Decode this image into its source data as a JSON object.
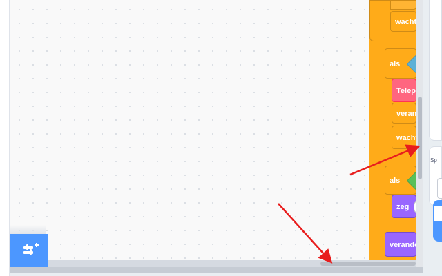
{
  "code_blocks": {
    "wacht_1": "wacht",
    "als_1": "als",
    "teleport": "Telepo",
    "verander_1": "verand",
    "wacht_2": "wacht",
    "als_2": "als",
    "zeg": "zeg",
    "verander_2": "verander"
  },
  "side_panel": {
    "label": "Sp"
  },
  "colors": {
    "control": "#ffab19",
    "looks": "#9966ff",
    "custom": "#ff6680",
    "operators_green": "#59c059",
    "sensing_blue": "#5cb1d6",
    "accent": "#4c97ff",
    "annotation_arrow": "#e81d1d"
  },
  "icons": {
    "add_extension": "add-extension-icon"
  }
}
